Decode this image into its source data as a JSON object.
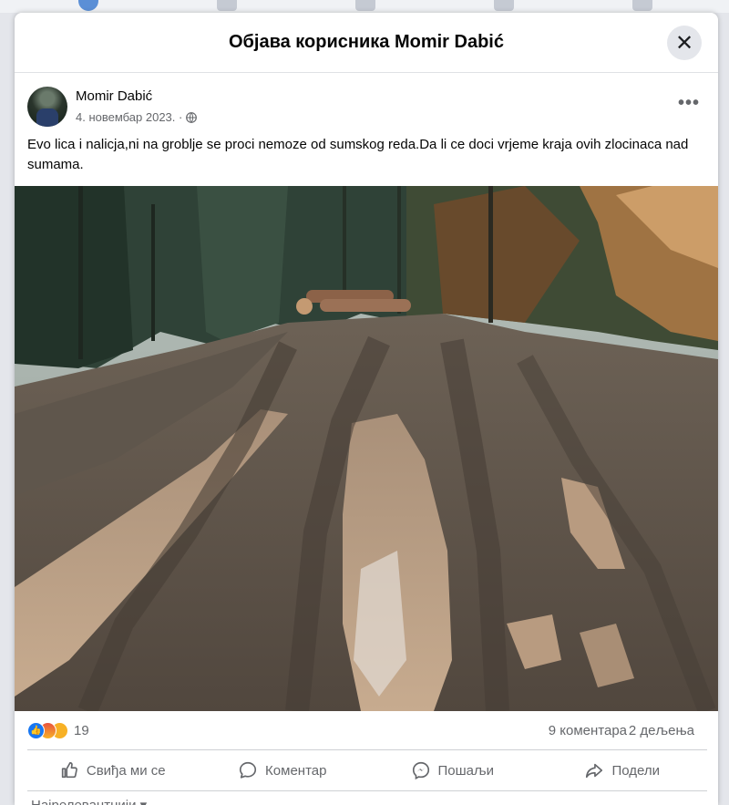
{
  "dialog": {
    "title": "Објава корисника Momir Dabić",
    "close_icon": "close-icon"
  },
  "post": {
    "author": "Momir Dabić",
    "date": "4. новембар 2023. ·",
    "privacy_icon": "globe-icon",
    "more_icon": "more-options-icon",
    "text": "Evo lica i nalicja,ni na groblje se proci nemoze od sumskog reda.Da li ce doci vrjeme kraja ovih zlocinaca nad sumama.",
    "photo_description_icon": "photo"
  },
  "stats": {
    "reaction_icons": [
      "like-icon",
      "angry-icon",
      "sad-icon"
    ],
    "reaction_count": "19",
    "comments": "9 коментара",
    "shares": "2 дељења"
  },
  "actions": [
    {
      "label": "Свиђа ми се",
      "icon": "like-icon"
    },
    {
      "label": "Коментар",
      "icon": "comment-icon"
    },
    {
      "label": "Пошаљи",
      "icon": "messenger-icon"
    },
    {
      "label": "Подели",
      "icon": "share-icon"
    }
  ],
  "comments_filter": "Најрелевантнији",
  "colors": {
    "accent": "#1877f2",
    "secondary_text": "#65676b",
    "overlay_bg": "#e4e6eb"
  }
}
